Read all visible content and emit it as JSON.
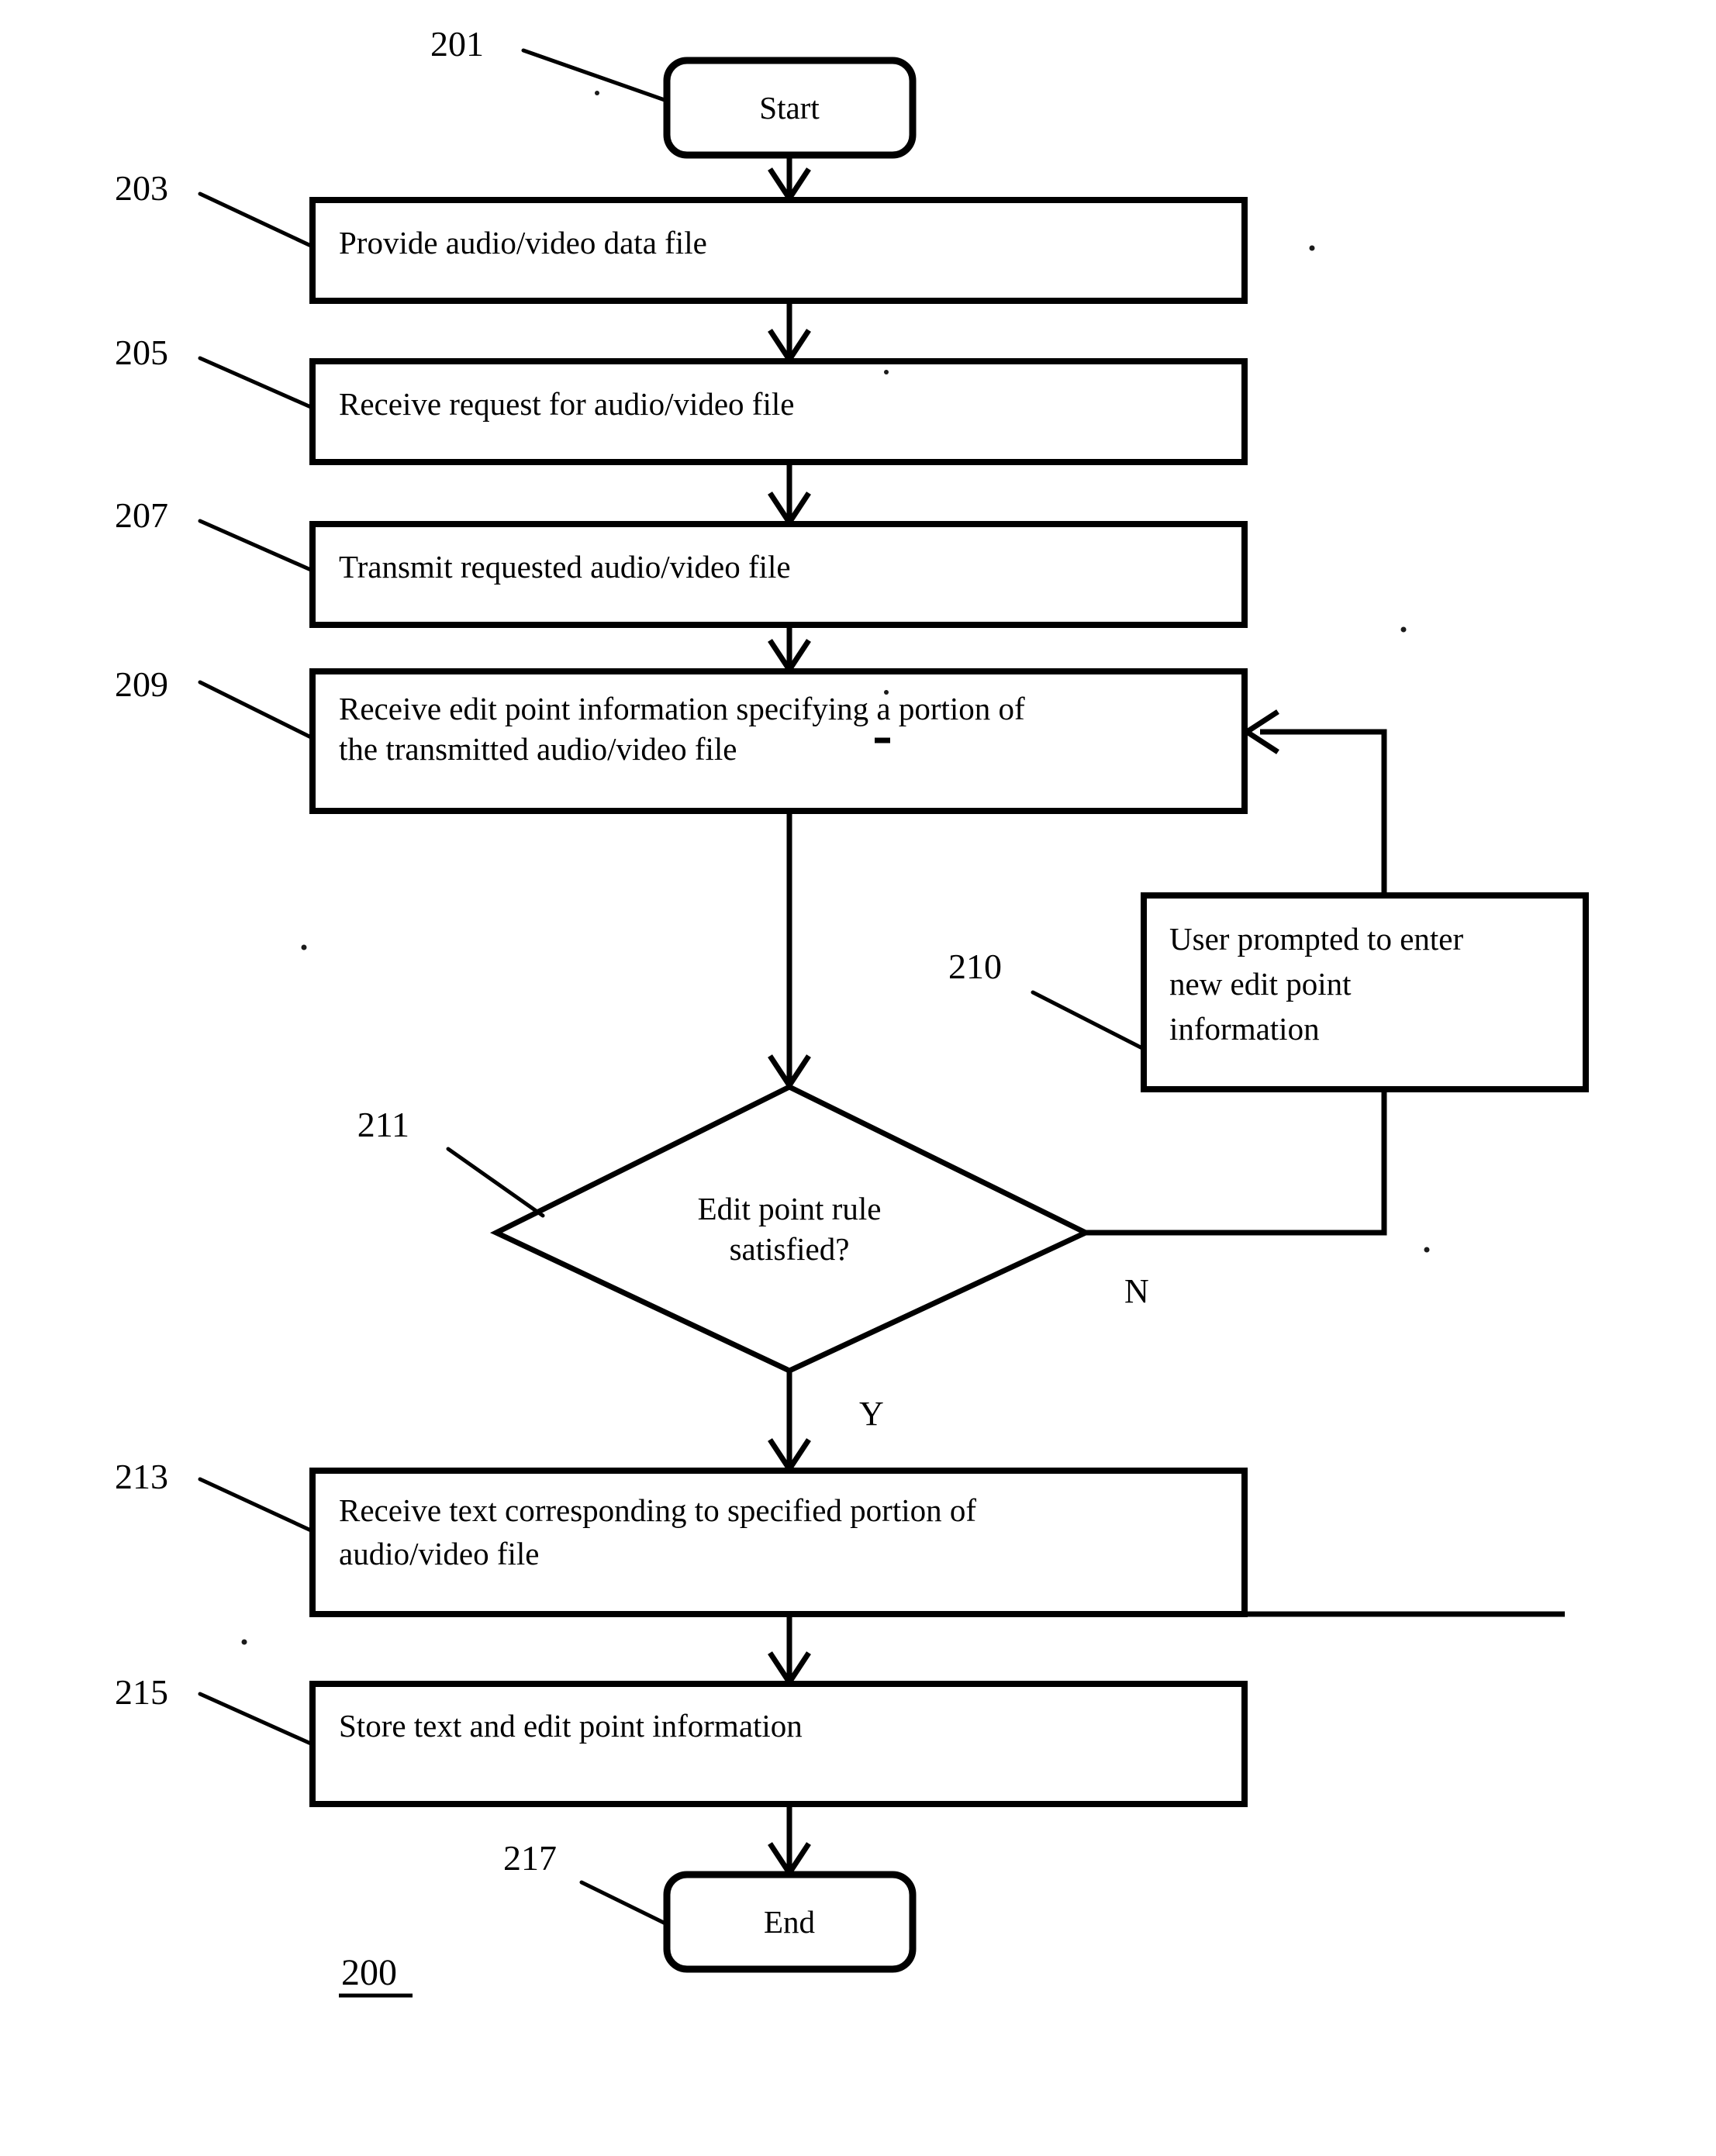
{
  "figure": {
    "number": "200",
    "type": "flowchart"
  },
  "nodes": {
    "start": {
      "ref": "201",
      "label": "Start",
      "shape": "rounded-terminal"
    },
    "provide_file": {
      "ref": "203",
      "label": "Provide audio/video data file",
      "shape": "process"
    },
    "receive_request": {
      "ref": "205",
      "label": "Receive request for audio/video file",
      "shape": "process"
    },
    "transmit_file": {
      "ref": "207",
      "label": "Transmit requested audio/video file",
      "shape": "process"
    },
    "receive_edit_point": {
      "ref": "209",
      "label_line1": "Receive edit point information specifying a portion of",
      "label_line2": "the transmitted audio/video file",
      "shape": "process"
    },
    "user_prompted": {
      "ref": "210",
      "label_line1": "User prompted to enter",
      "label_line2": "new edit point",
      "label_line3": "information",
      "shape": "process"
    },
    "edit_point_rule": {
      "ref": "211",
      "label_line1": "Edit point rule",
      "label_line2": "satisfied?",
      "shape": "decision"
    },
    "receive_text": {
      "ref": "213",
      "label_line1": "Receive text corresponding to specified portion of",
      "label_line2": "audio/video file",
      "shape": "process"
    },
    "store_text": {
      "ref": "215",
      "label": "Store text and edit point information",
      "shape": "process"
    },
    "end": {
      "ref": "217",
      "label": "End",
      "shape": "rounded-terminal"
    }
  },
  "branch_labels": {
    "no": "N",
    "yes": "Y"
  },
  "colors": {
    "ink": "#000000",
    "background": "#ffffff"
  }
}
